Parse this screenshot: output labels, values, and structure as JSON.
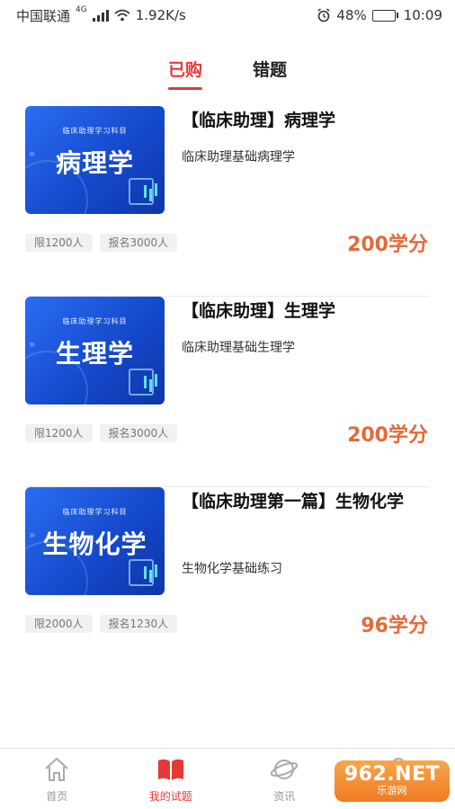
{
  "status": {
    "carrier": "中国联通",
    "network": "4G",
    "speed": "1.92K/s",
    "battery": "48%",
    "battery_level": 0.48,
    "time": "10:09"
  },
  "tabs": [
    {
      "label": "已购",
      "active": true
    },
    {
      "label": "错题",
      "active": false
    }
  ],
  "items": [
    {
      "thumb_sub": "临床助理学习科目",
      "thumb_title": "病理学",
      "title": "【临床助理】病理学",
      "desc": "临床助理基础病理学",
      "tags": [
        "限1200人",
        "报名3000人"
      ],
      "price": "200学分"
    },
    {
      "thumb_sub": "临床助理学习科目",
      "thumb_title": "生理学",
      "title": "【临床助理】生理学",
      "desc": "临床助理基础生理学",
      "tags": [
        "限1200人",
        "报名3000人"
      ],
      "price": "200学分"
    },
    {
      "thumb_sub": "临床助理学习科目",
      "thumb_title": "生物化学",
      "title": "【临床助理第一篇】生物化学",
      "desc": "生物化学基础练习",
      "tags": [
        "限2000人",
        "报名1230人"
      ],
      "price": "96学分"
    }
  ],
  "nav": [
    {
      "label": "首页",
      "icon": "home-icon",
      "active": false
    },
    {
      "label": "我的试题",
      "icon": "book-icon",
      "active": true
    },
    {
      "label": "资讯",
      "icon": "planet-icon",
      "active": false
    },
    {
      "label": "",
      "icon": "user-icon",
      "active": false
    }
  ],
  "watermark": {
    "top": "962.NET",
    "bottom": "乐游网"
  },
  "colors": {
    "accent": "#e53935",
    "price": "#e36a3a",
    "thumb": "#1f5ce0"
  }
}
